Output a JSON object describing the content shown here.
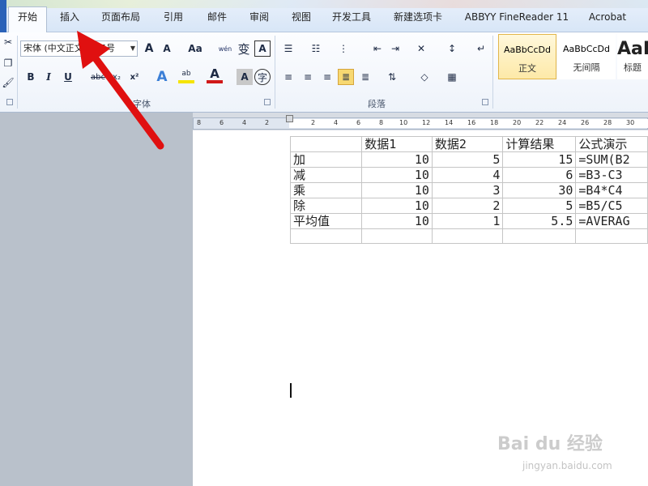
{
  "tabs": [
    "开始",
    "插入",
    "页面布局",
    "引用",
    "邮件",
    "审阅",
    "视图",
    "开发工具",
    "新建选项卡",
    "ABBYY FineReader 11",
    "Acrobat"
  ],
  "font_group": {
    "font_name": "宋体 (中文正文)",
    "font_size": "五号",
    "grow_label": "A",
    "shrink_label": "A",
    "case_label": "Aa",
    "wen_label": "wén",
    "bian_label": "变",
    "a_box": "A",
    "bold": "B",
    "italic": "I",
    "underline": "U",
    "strike": "abc",
    "subscript": "x₂",
    "superscript": "x²",
    "text_effect": "A",
    "highlight": "ab",
    "font_color": "A",
    "char_shade": "A",
    "enclose": "字",
    "label": "字体"
  },
  "paragraph_group": {
    "label": "段落"
  },
  "styles": [
    {
      "sample": "AaBbCcDd",
      "name": "正文"
    },
    {
      "sample": "AaBbCcDd",
      "name": "无间隔"
    },
    {
      "sample": "AaI",
      "name": "标题"
    }
  ],
  "ruler": [
    "8",
    "6",
    "4",
    "2",
    "",
    "2",
    "4",
    "6",
    "8",
    "10",
    "12",
    "14",
    "16",
    "18",
    "20",
    "22",
    "24",
    "26",
    "28",
    "30"
  ],
  "table": {
    "header": [
      "",
      "数据1",
      "数据2",
      "计算结果",
      "公式演示"
    ],
    "rows": [
      [
        "加",
        "10",
        "5",
        "15",
        "=SUM(B2"
      ],
      [
        "减",
        "10",
        "4",
        "6",
        "=B3-C3"
      ],
      [
        "乘",
        "10",
        "3",
        "30",
        "=B4*C4"
      ],
      [
        "除",
        "10",
        "2",
        "5",
        "=B5/C5"
      ],
      [
        "平均值",
        "10",
        "1",
        "5.5",
        "=AVERAG"
      ],
      [
        "",
        "",
        "",
        "",
        ""
      ]
    ]
  },
  "watermark": {
    "brand": "Bai du 经验",
    "url": "jingyan.baidu.com"
  },
  "colors": {
    "highlight": "#f5e400",
    "font_red": "#d01818",
    "arrow": "#e01010",
    "selected": "#f7d871"
  }
}
